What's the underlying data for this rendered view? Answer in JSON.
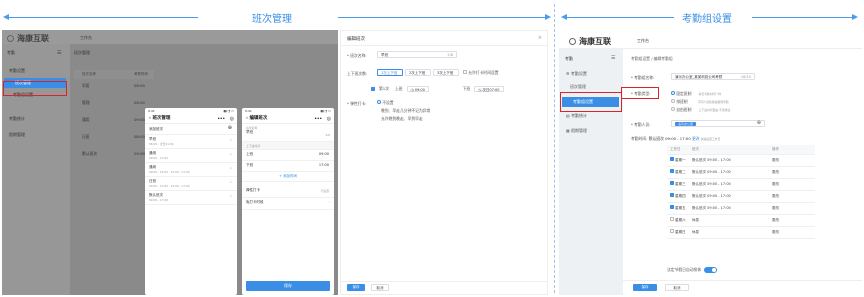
{
  "headers": {
    "left": "班次管理",
    "right": "考勤组设置"
  },
  "left_app": {
    "brand": "海康互联",
    "workspace": "工作台",
    "menu_title": "考勤",
    "breadcrumb": "班次管理",
    "side_items": [
      "考勤设置",
      "班次管理",
      "考勤组设置",
      "考勤统计",
      "假期管理"
    ],
    "table_header": [
      "班次名称",
      "考勤时间"
    ],
    "table_rows": [
      {
        "name": "早班",
        "time": "08:00"
      },
      {
        "name": "管理",
        "time": "08:00"
      },
      {
        "name": "通用",
        "time": "09:00"
      },
      {
        "name": "日班",
        "time": "08:00"
      },
      {
        "name": "默认班次",
        "time": "09:00"
      }
    ]
  },
  "phone1": {
    "status_time": "9:41",
    "title": "班次管理",
    "add_label": "添加班次",
    "shifts": [
      {
        "name": "早班",
        "time": "06:00 - 次日01:00"
      },
      {
        "name": "通用",
        "time": "09:00 - 17:00"
      },
      {
        "name": "通用",
        "time": "09:00 - 12:00 · 13:00 - 17:00"
      },
      {
        "name": "日班",
        "time": "09:00 - 11:00 · 13:00 - 17:00"
      },
      {
        "name": "默认班次",
        "time": "09:00 - 17:00"
      }
    ]
  },
  "phone2": {
    "status_time": "9:41",
    "title": "编辑班次",
    "name_label": "班次名称",
    "name_value": "早班",
    "count": "2/8",
    "time_section": "上下班时间",
    "on_label": "上班",
    "on_time": "09:00",
    "off_label": "下班",
    "off_time": "17:00",
    "add_time": "添加时间",
    "flex_label": "弹性打卡",
    "flex_value": "不设置",
    "free_label": "免打卡时段",
    "save": "保存"
  },
  "dialog": {
    "title": "编辑班次",
    "name_label": "* 班次名称:",
    "name_value": "早班",
    "name_count": "2/8",
    "times_label": "上下班次数:",
    "times_options": [
      "1次上下班",
      "2次上下班",
      "3次上下班"
    ],
    "free_checkbox": "允许打卡时间设置",
    "time_row_label": "第1次",
    "on_label": "上班",
    "on_time": "09:00",
    "off_label": "下班",
    "off_time": "次日07:00",
    "flex_label": "* 弹性打卡:",
    "flex_options": [
      "不设置",
      "晚到、早走几分钟不记为异常",
      "允许晚到晚走、早到早走"
    ],
    "save": "保存",
    "cancel": "取消"
  },
  "right_app": {
    "brand": "海康互联",
    "workspace": "工作台",
    "menu_title": "考勤",
    "side_items": [
      "考勤设置",
      "班次管理",
      "考勤组设置",
      "考勤统计",
      "假期管理"
    ],
    "breadcrumb": "考勤组设置 / 编辑考勤组",
    "group_name_label": "* 考勤组名称:",
    "group_name_value": "演示办公室_某某科技公司考勤",
    "group_name_count": "18/15",
    "type_label": "* 考勤类型:",
    "types": [
      {
        "name": "固定班制",
        "desc": "每天考勤时间一样"
      },
      {
        "name": "排班制",
        "desc": "不同人员按排班规则考勤"
      },
      {
        "name": "自由班制",
        "desc": "上下班时间自由,不需排班"
      }
    ],
    "members_label": "* 考勤人员:",
    "members_value": "演示办公室",
    "time_label": "考勤时间:",
    "time_summary": "默认班次 09:00 - 17:00",
    "time_change": "更改",
    "time_note": "快速设置工作日",
    "table_header": [
      "工作日",
      "班次",
      "操作"
    ],
    "days": [
      {
        "day": "星期一",
        "shift": "默认班次 09:00 - 17:00",
        "op": "更改",
        "on": true
      },
      {
        "day": "星期二",
        "shift": "默认班次 09:00 - 17:00",
        "op": "更改",
        "on": true
      },
      {
        "day": "星期三",
        "shift": "默认班次 09:00 - 17:00",
        "op": "更改",
        "on": true
      },
      {
        "day": "星期四",
        "shift": "默认班次 09:00 - 17:00",
        "op": "更改",
        "on": true
      },
      {
        "day": "星期五",
        "shift": "默认班次 09:00 - 17:00",
        "op": "更改",
        "on": true
      },
      {
        "day": "星期六",
        "shift": "休息",
        "op": "更改",
        "on": false
      },
      {
        "day": "星期日",
        "shift": "休息",
        "op": "更改",
        "on": false
      }
    ],
    "holiday_label": "法定节假日自动排休",
    "save": "保存",
    "cancel": "取消"
  },
  "colors": {
    "accent": "#3a8ee6",
    "highlight": "#d9242a",
    "sidebar": "#eef1f4"
  }
}
